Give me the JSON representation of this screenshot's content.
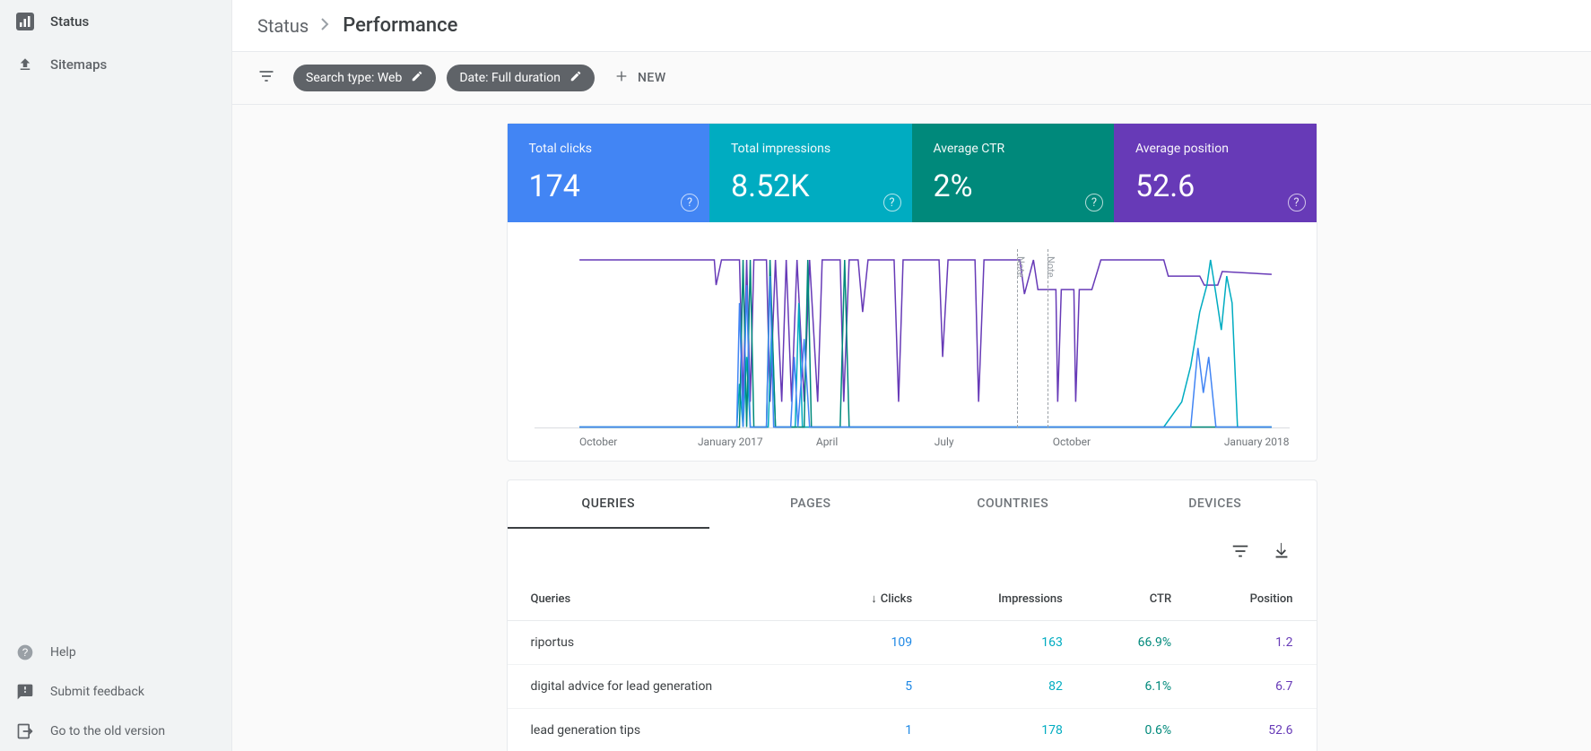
{
  "sidebar": {
    "items": [
      {
        "label": "Status",
        "icon": "analytics"
      },
      {
        "label": "Sitemaps",
        "icon": "upload"
      }
    ],
    "bottom": [
      {
        "label": "Help",
        "icon": "help"
      },
      {
        "label": "Submit feedback",
        "icon": "feedback"
      },
      {
        "label": "Go to the old version",
        "icon": "exit"
      }
    ]
  },
  "breadcrumb": {
    "parent": "Status",
    "current": "Performance"
  },
  "filters": {
    "chips": [
      {
        "label": "Search type: Web"
      },
      {
        "label": "Date: Full duration"
      }
    ],
    "new_label": "NEW"
  },
  "metrics": [
    {
      "label": "Total clicks",
      "value": "174",
      "color": "blue"
    },
    {
      "label": "Total impressions",
      "value": "8.52K",
      "color": "teal"
    },
    {
      "label": "Average CTR",
      "value": "2%",
      "color": "green"
    },
    {
      "label": "Average position",
      "value": "52.6",
      "color": "purple"
    }
  ],
  "chart": {
    "x_labels": [
      "October",
      "January 2017",
      "April",
      "July",
      "October",
      "January 2018"
    ],
    "notes": [
      "Note",
      "Note"
    ]
  },
  "tabs": [
    "QUERIES",
    "PAGES",
    "COUNTRIES",
    "DEVICES"
  ],
  "table": {
    "headers": {
      "query": "Queries",
      "clicks": "Clicks",
      "impressions": "Impressions",
      "ctr": "CTR",
      "position": "Position"
    },
    "rows": [
      {
        "query": "riportus",
        "clicks": "109",
        "impressions": "163",
        "ctr": "66.9%",
        "position": "1.2"
      },
      {
        "query": "digital advice for lead generation",
        "clicks": "5",
        "impressions": "82",
        "ctr": "6.1%",
        "position": "6.7"
      },
      {
        "query": "lead generation tips",
        "clicks": "1",
        "impressions": "178",
        "ctr": "0.6%",
        "position": "52.6"
      }
    ]
  }
}
